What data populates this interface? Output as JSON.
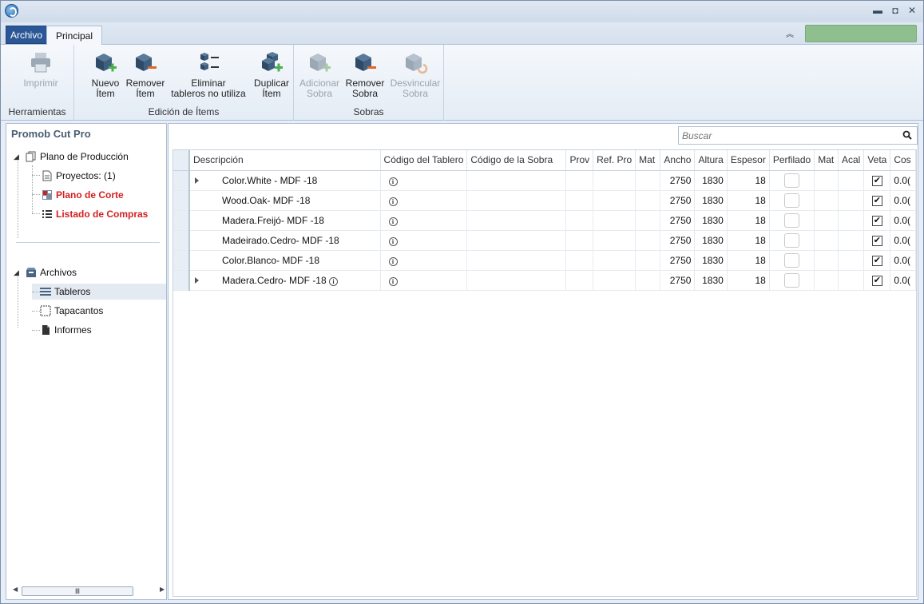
{
  "tabs": {
    "archivo": "Archivo",
    "principal": "Principal"
  },
  "ribbon": {
    "herramientas": {
      "label": "Herramientas",
      "imprimir": "Imprimir"
    },
    "edicion": {
      "label": "Edición de Ítems",
      "nuevo": [
        "Nuevo",
        "Ítem"
      ],
      "remover": [
        "Remover",
        "Ítem"
      ],
      "eliminar": [
        "Eliminar",
        "tableros no utiliza"
      ],
      "duplicar": [
        "Duplicar",
        "Ítem"
      ]
    },
    "sobras": {
      "label": "Sobras",
      "adicionar": [
        "Adicionar",
        "Sobra"
      ],
      "remover": [
        "Remover",
        "Sobra"
      ],
      "desvincular": [
        "Desvincular",
        "Sobra"
      ]
    }
  },
  "sidebar": {
    "title": "Promob Cut Pro",
    "plano_produccion": "Plano de Producción",
    "proyectos": "Proyectos: (1)",
    "plano_corte": "Plano de Corte",
    "listado_compras": "Listado de Compras",
    "archivos": "Archivos",
    "tableros": "Tableros",
    "tapacantos": "Tapacantos",
    "informes": "Informes"
  },
  "search": {
    "placeholder": "Buscar"
  },
  "grid": {
    "columns": [
      "Descripción",
      "Código del Tablero",
      "Código de la Sobra",
      "Prov",
      "Ref. Pro",
      "Mat",
      "Ancho",
      "Altura",
      "Espesor",
      "Perfilado",
      "Mat",
      "Acal",
      "Veta",
      "Cos"
    ],
    "rows": [
      {
        "expandable": true,
        "desc": "Color.White - MDF -18",
        "desc_info": false,
        "ancho": "2750",
        "altura": "1830",
        "espesor": "18",
        "cos": "0.0("
      },
      {
        "expandable": false,
        "desc": "Wood.Oak- MDF -18",
        "desc_info": false,
        "ancho": "2750",
        "altura": "1830",
        "espesor": "18",
        "cos": "0.0("
      },
      {
        "expandable": false,
        "desc": "Madera.Freijó- MDF -18",
        "desc_info": false,
        "ancho": "2750",
        "altura": "1830",
        "espesor": "18",
        "cos": "0.0("
      },
      {
        "expandable": false,
        "desc": "Madeirado.Cedro- MDF -18",
        "desc_info": false,
        "ancho": "2750",
        "altura": "1830",
        "espesor": "18",
        "cos": "0.0("
      },
      {
        "expandable": false,
        "desc": "Color.Blanco- MDF -18",
        "desc_info": false,
        "ancho": "2750",
        "altura": "1830",
        "espesor": "18",
        "cos": "0.0("
      },
      {
        "expandable": true,
        "desc": "Madera.Cedro- MDF -18",
        "desc_info": true,
        "ancho": "2750",
        "altura": "1830",
        "espesor": "18",
        "cos": "0.0("
      }
    ]
  },
  "colors": {
    "accent": "#2b5797",
    "red": "#d32020",
    "status": "#8fbf8f"
  }
}
